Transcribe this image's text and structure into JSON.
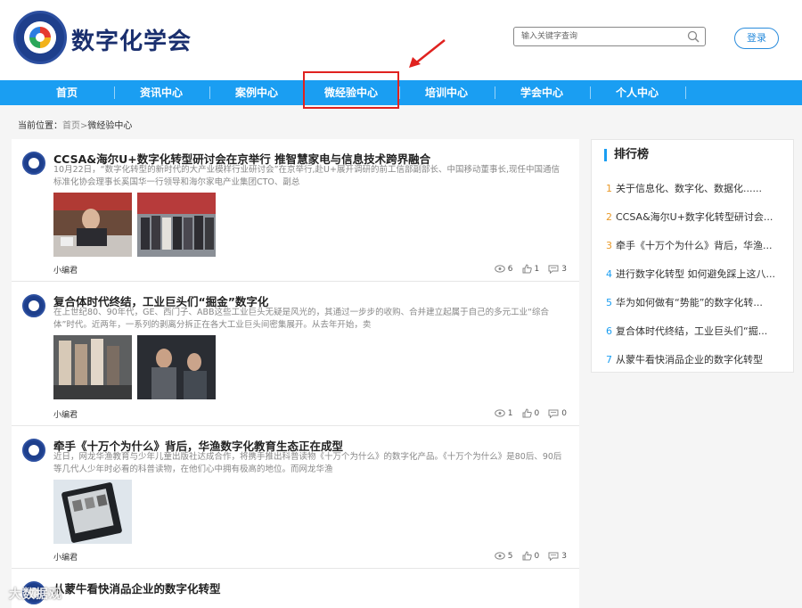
{
  "header": {
    "logo_text": "数字化学会",
    "search_placeholder": "输入关键字查询",
    "login_label": "登录"
  },
  "nav": {
    "items": [
      "首页",
      "资讯中心",
      "案例中心",
      "微经验中心",
      "培训中心",
      "学会中心",
      "个人中心"
    ],
    "active": "微经验中心"
  },
  "breadcrumb": {
    "prefix": "当前位置：",
    "home": "首页",
    "sep": ">",
    "current": "微经验中心"
  },
  "articles": [
    {
      "title": "CCSA&海尔U+数字化转型研讨会在京举行 推智慧家电与信息技术跨界融合",
      "summary": "10月22日，“数字化转型的新时代的大产业模样行业研讨会”在京举行,赴U+展开调研的前工信部副部长、中国移动董事长,现任中国通信标准化协会理事长奚国华一行领导和海尔家电产业集团CTO、副总",
      "author": "小编君",
      "views": "6",
      "likes": "1",
      "comments": "3"
    },
    {
      "title": "复合体时代终结，工业巨头们“掘金”数字化",
      "summary": "在上世纪80、90年代，GE、西门子、ABB这些工业巨头无疑是风光的，其通过一步步的收购、合并建立起属于自己的多元工业“综合体”时代。近两年，一系列的剥离分拆正在各大工业巨头间密集展开。从去年开始，卖",
      "author": "小编君",
      "views": "1",
      "likes": "0",
      "comments": "0"
    },
    {
      "title": "牵手《十万个为什么》背后，华渔数字化教育生态正在成型",
      "summary": "近日，网龙华渔教育与少年儿童出版社达成合作，将携手推出科普读物《十万个为什么》的数字化产品。《十万个为什么》是80后、90后等几代人少年时必看的科普读物，在他们心中拥有极高的地位。而网龙华渔",
      "author": "小编君",
      "views": "5",
      "likes": "0",
      "comments": "3"
    },
    {
      "title": "从蒙牛看快消品企业的数字化转型",
      "summary": "",
      "author": "",
      "views": "",
      "likes": "",
      "comments": ""
    }
  ],
  "ranking": {
    "title": "排行榜",
    "items": [
      {
        "num": "1",
        "text": "关于信息化、数字化、数据化......"
      },
      {
        "num": "2",
        "text": "CCSA&海尔U+数字化转型研讨会..."
      },
      {
        "num": "3",
        "text": "牵手《十万个为什么》背后，华渔..."
      },
      {
        "num": "4",
        "text": "进行数字化转型 如何避免踩上这八..."
      },
      {
        "num": "5",
        "text": "华为如何做有“势能”的数字化转..."
      },
      {
        "num": "6",
        "text": "复合体时代终结，工业巨头们“掘..."
      },
      {
        "num": "7",
        "text": "从蒙牛看快消品企业的数字化转型"
      }
    ]
  },
  "watermark": "大数据观",
  "colors": {
    "nav_bg": "#1a9ef2",
    "highlight_border": "#e0221f",
    "logo_text": "#1a2f6e",
    "rank_top": "#e99a2a",
    "rank_num": "#1a9ef2"
  }
}
